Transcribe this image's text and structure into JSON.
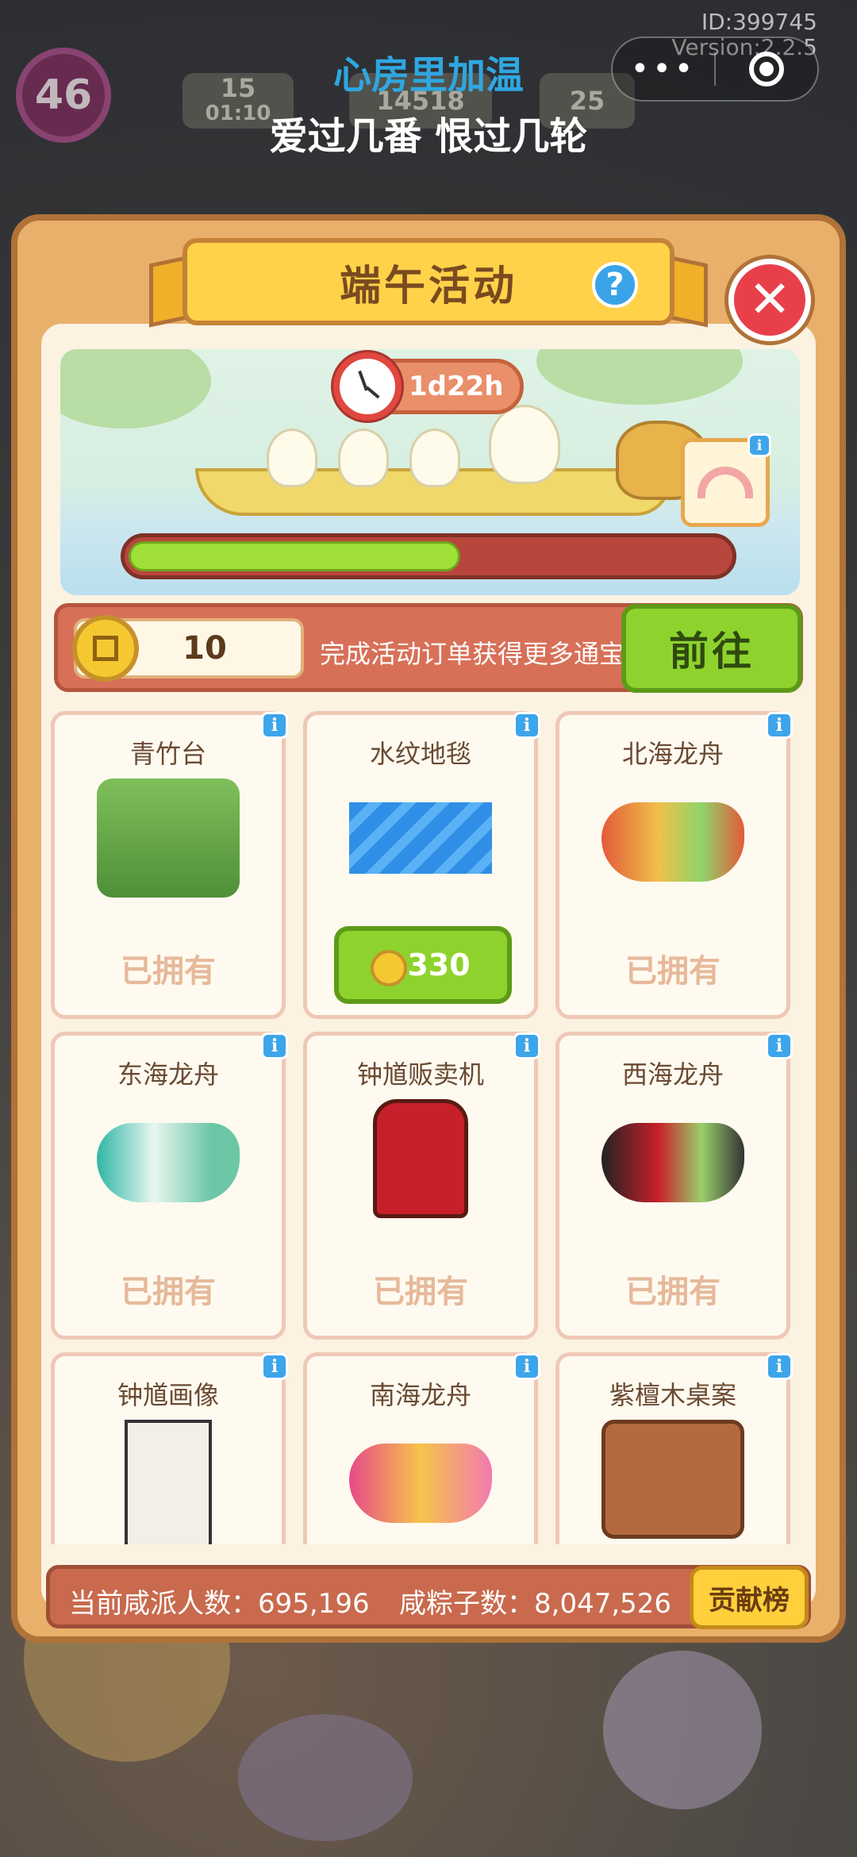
{
  "hud": {
    "id_text": "ID:399745",
    "version_text": "Version:2.2.5",
    "level": "46",
    "energy": "15",
    "energy_timer": "01:10",
    "coins": "14518",
    "gems": "25"
  },
  "song": {
    "title": "心房里加温",
    "subtitle": "爱过几番 恨过几轮"
  },
  "panel": {
    "title": "端午活动",
    "timer": "1d22h",
    "progress_fraction": 0.55
  },
  "coin_bar": {
    "count": "10",
    "hint": "完成活动订单获得更多通宝",
    "go_label": "前往"
  },
  "items": [
    {
      "name": "青竹台",
      "status": "已拥有"
    },
    {
      "name": "水纹地毯",
      "price": "330"
    },
    {
      "name": "北海龙舟",
      "status": "已拥有"
    },
    {
      "name": "东海龙舟",
      "status": "已拥有"
    },
    {
      "name": "钟馗贩卖机",
      "status": "已拥有"
    },
    {
      "name": "西海龙舟",
      "status": "已拥有"
    },
    {
      "name": "钟馗画像"
    },
    {
      "name": "南海龙舟"
    },
    {
      "name": "紫檀木桌案"
    }
  ],
  "stats": {
    "salty_label": "当前咸派人数：695,196",
    "zongzi_label": "咸粽子数：8,047,526",
    "rank_label": "贡献榜"
  },
  "colors": {
    "panel_bg": "#e9b06b",
    "title_banner": "#ffd249",
    "go_button": "#8ed32d",
    "progress_fill": "#a0e038",
    "close_button": "#e8404a",
    "info_icon": "#3da5ea"
  },
  "icons": {
    "help": "question-mark-icon",
    "close": "close-icon",
    "clock": "clock-icon",
    "coin": "coin-icon",
    "info": "info-icon"
  }
}
